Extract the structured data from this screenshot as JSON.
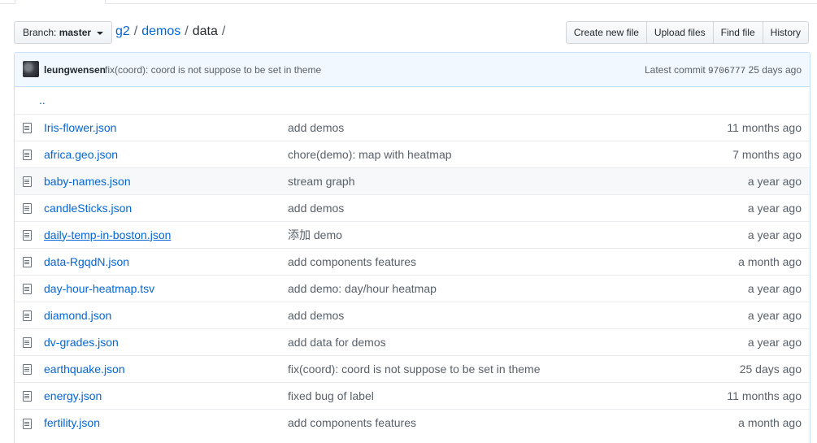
{
  "nav": {
    "branch_prefix": "Branch:",
    "branch_name": "master",
    "breadcrumb": {
      "repo": "g2",
      "dir": "demos",
      "current": "data",
      "sep": "/"
    },
    "actions": [
      "Create new file",
      "Upload files",
      "Find file",
      "History"
    ]
  },
  "commit": {
    "author": "leungwensen",
    "message": "fix(coord): coord is not suppose to be set in theme",
    "latest_label": "Latest commit",
    "sha": "9706777",
    "age": "25 days ago"
  },
  "parent_dir": "..",
  "files": [
    {
      "name": "Iris-flower.json",
      "message": "add demos",
      "age": "11 months ago"
    },
    {
      "name": "africa.geo.json",
      "message": "chore(demo): map with heatmap",
      "age": "7 months ago"
    },
    {
      "name": "baby-names.json",
      "message": "stream graph",
      "age": "a year ago"
    },
    {
      "name": "candleSticks.json",
      "message": "add demos",
      "age": "a year ago"
    },
    {
      "name": "daily-temp-in-boston.json",
      "message": "添加 demo",
      "age": "a year ago"
    },
    {
      "name": "data-RgqdN.json",
      "message": "add components features",
      "age": "a month ago"
    },
    {
      "name": "day-hour-heatmap.tsv",
      "message": "add demo: day/hour heatmap",
      "age": "a year ago"
    },
    {
      "name": "diamond.json",
      "message": "add demos",
      "age": "a year ago"
    },
    {
      "name": "dv-grades.json",
      "message": "add data for demos",
      "age": "a year ago"
    },
    {
      "name": "earthquake.json",
      "message": "fix(coord): coord is not suppose to be set in theme",
      "age": "25 days ago"
    },
    {
      "name": "energy.json",
      "message": "fixed bug of label",
      "age": "11 months ago"
    },
    {
      "name": "fertility.json",
      "message": "add components features",
      "age": "a month ago"
    }
  ],
  "colors": {
    "link": "#0366d6",
    "commit_bg": "#f1f8ff",
    "row_alt": "#f6f8fa"
  }
}
